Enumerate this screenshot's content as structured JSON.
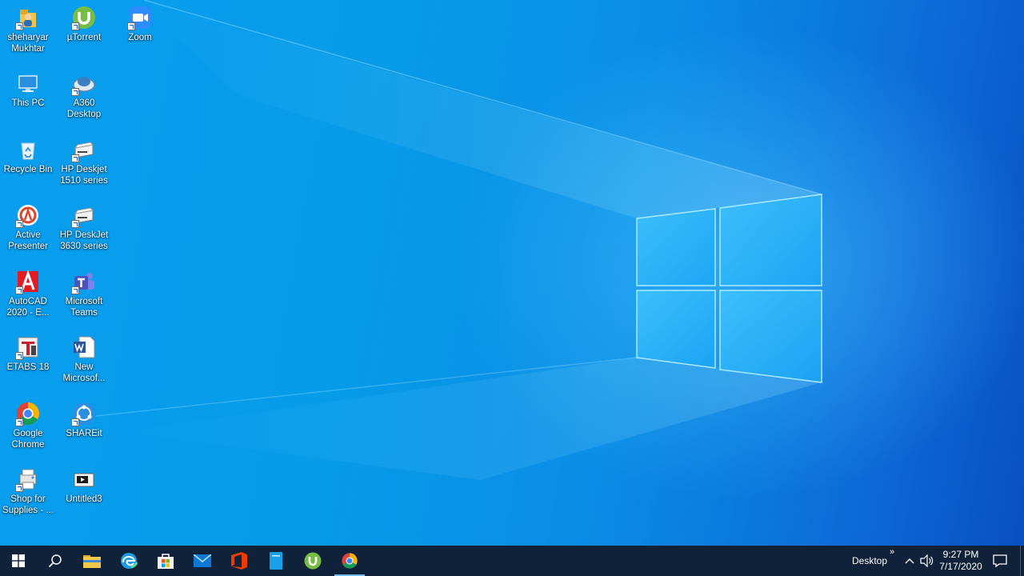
{
  "desktop_icons": [
    {
      "label": "sheharyar Mukhtar",
      "icon": "user-folder-icon"
    },
    {
      "label": "This PC",
      "icon": "computer-icon"
    },
    {
      "label": "Recycle Bin",
      "icon": "recycle-bin-icon"
    },
    {
      "label": "Active Presenter",
      "icon": "active-presenter-icon"
    },
    {
      "label": "AutoCAD 2020 - E...",
      "icon": "autocad-icon"
    },
    {
      "label": "ETABS 18",
      "icon": "etabs-icon"
    },
    {
      "label": "Google Chrome",
      "icon": "chrome-icon"
    },
    {
      "label": "Shop for Supplies - ...",
      "icon": "printer-shop-icon"
    },
    {
      "label": "µTorrent",
      "icon": "utorrent-icon"
    },
    {
      "label": "A360 Desktop",
      "icon": "a360-icon"
    },
    {
      "label": "HP Deskjet 1510 series",
      "icon": "printer-icon"
    },
    {
      "label": "HP DeskJet 3630 series",
      "icon": "printer-icon"
    },
    {
      "label": "Microsoft Teams",
      "icon": "teams-icon"
    },
    {
      "label": "New Microsof...",
      "icon": "word-document-icon"
    },
    {
      "label": "SHAREit",
      "icon": "shareit-icon"
    },
    {
      "label": "Untitled3",
      "icon": "video-file-icon"
    },
    {
      "label": "Zoom",
      "icon": "zoom-icon"
    }
  ],
  "taskbar": {
    "pinned": [
      {
        "name": "start-button",
        "icon": "windows-logo-icon"
      },
      {
        "name": "search-button",
        "icon": "search-icon"
      },
      {
        "name": "file-explorer-button",
        "icon": "folder-icon"
      },
      {
        "name": "edge-button",
        "icon": "edge-icon"
      },
      {
        "name": "store-button",
        "icon": "store-icon"
      },
      {
        "name": "mail-button",
        "icon": "mail-icon"
      },
      {
        "name": "office-button",
        "icon": "office-icon"
      },
      {
        "name": "notes-button",
        "icon": "notes-icon"
      },
      {
        "name": "utorrent-button",
        "icon": "utorrent-icon"
      },
      {
        "name": "chrome-button",
        "icon": "chrome-icon",
        "active": true
      }
    ],
    "tray": {
      "toolbar_label": "Desktop",
      "toolbar_overflow": "»",
      "time": "9:27 PM",
      "date": "7/17/2020"
    }
  },
  "colors": {
    "taskbar_bg": "#10223a",
    "active_underline": "#76b9ed",
    "wallpaper_blue": "#0a8ee6"
  }
}
